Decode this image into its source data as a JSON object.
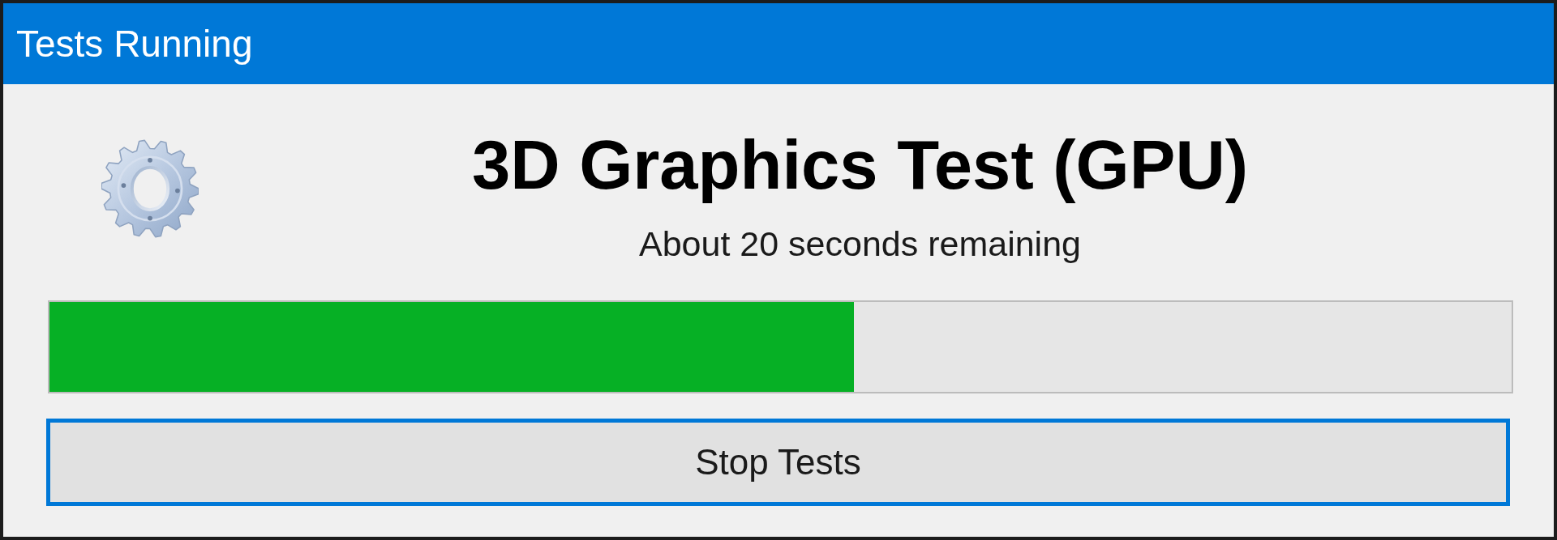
{
  "window": {
    "title": "Tests Running"
  },
  "test": {
    "name": "3D Graphics Test (GPU)",
    "status": "About 20 seconds remaining"
  },
  "progress": {
    "level": 0.55
  },
  "stop_button": {
    "label": "Stop Tests",
    "focused": true
  }
}
